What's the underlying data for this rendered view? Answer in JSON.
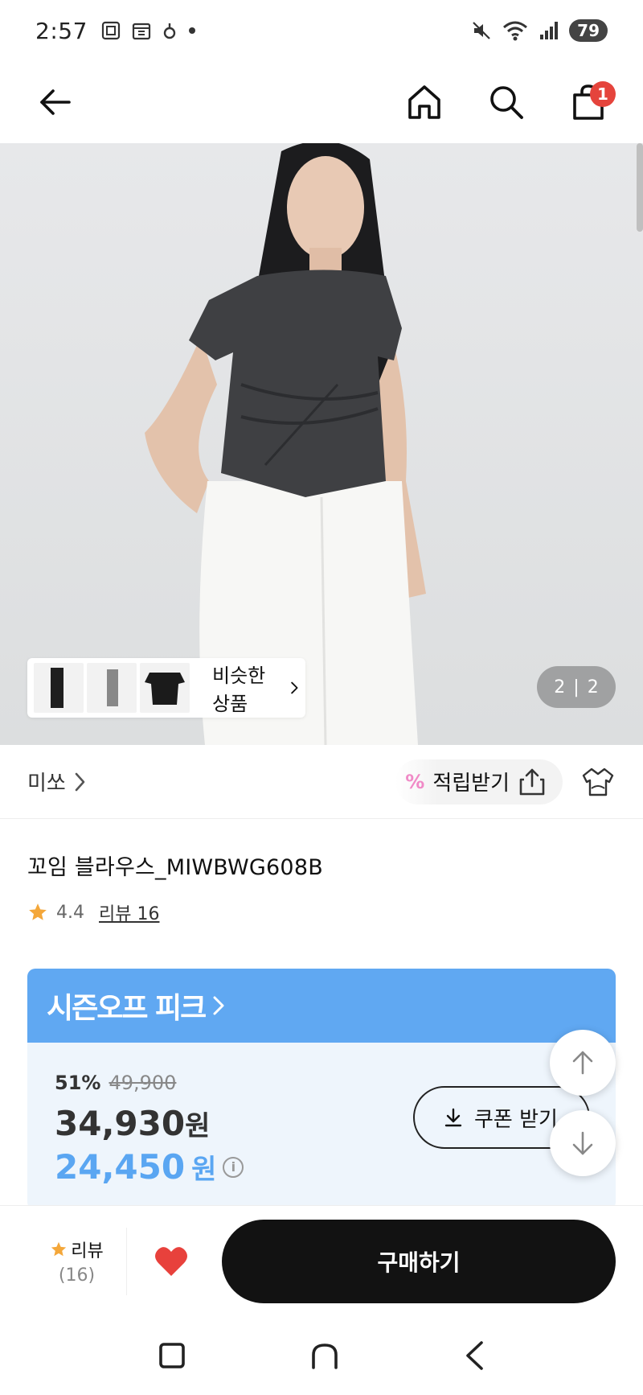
{
  "status_bar": {
    "time": "2:57",
    "battery": "79"
  },
  "nav": {
    "cart_count": "1"
  },
  "hero": {
    "similar_label": "비슷한 상품",
    "counter_current": "2",
    "counter_sep": "|",
    "counter_total": "2"
  },
  "brand": {
    "name": "미쏘",
    "reward_pct": "%",
    "reward_label": "적립받기"
  },
  "product": {
    "title": "꼬임 블라우스_MIWBWG608B",
    "rating": "4.4",
    "review_link": "리뷰 16"
  },
  "promo": {
    "title": "시즌오프 피크",
    "discount_pct": "51%",
    "original_price": "49,900",
    "price": "34,930",
    "coupon_price": "24,450",
    "currency": "원",
    "coupon_button": "쿠폰 받기",
    "info": "i"
  },
  "bottom_bar": {
    "review_label": "리뷰",
    "review_count": "(16)",
    "buy_button": "구매하기"
  },
  "colors": {
    "accent_blue": "#60a8f2",
    "price_blue": "#5aa6f2",
    "badge_red": "#e5443c",
    "heart_red": "#e8413c",
    "star": "#f4a73a"
  }
}
